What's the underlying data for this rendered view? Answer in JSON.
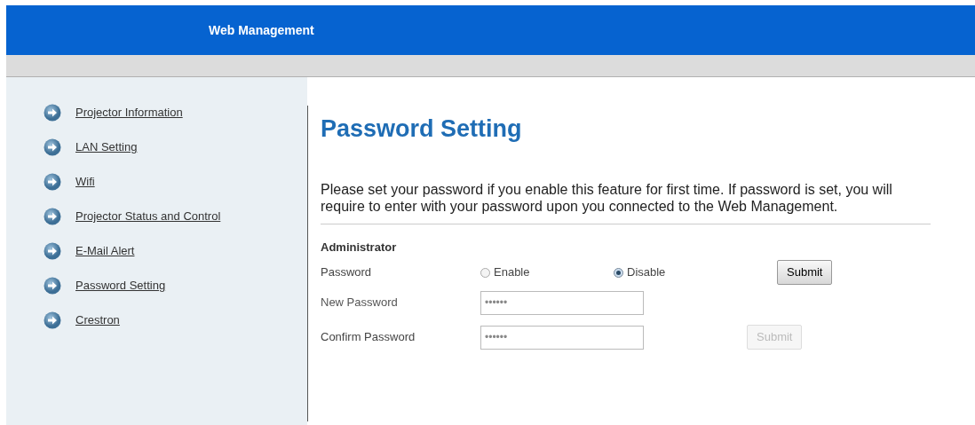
{
  "header": {
    "title": "Web Management"
  },
  "sidebar": {
    "items": [
      {
        "label": "Projector Information"
      },
      {
        "label": "LAN Setting"
      },
      {
        "label": "Wifi"
      },
      {
        "label": "Projector Status and Control"
      },
      {
        "label": "E-Mail Alert"
      },
      {
        "label": "Password Setting"
      },
      {
        "label": "Crestron"
      }
    ]
  },
  "page_title": "Password Setting",
  "description": "Please set your password if you enable this feature for first time. If password is set, you will require to enter with your password upon you connected to the Web Management.",
  "section": "Administrator",
  "password_row": {
    "label": "Password",
    "options": [
      {
        "label": "Enable",
        "selected": false
      },
      {
        "label": "Disable",
        "selected": true
      }
    ],
    "button": {
      "label": "Submit",
      "disabled": false
    }
  },
  "new_password": {
    "label": "New Password",
    "value": "••••••"
  },
  "confirm_password": {
    "label": "Confirm Password",
    "value": "••••••",
    "button": {
      "label": "Submit",
      "disabled": true
    }
  }
}
